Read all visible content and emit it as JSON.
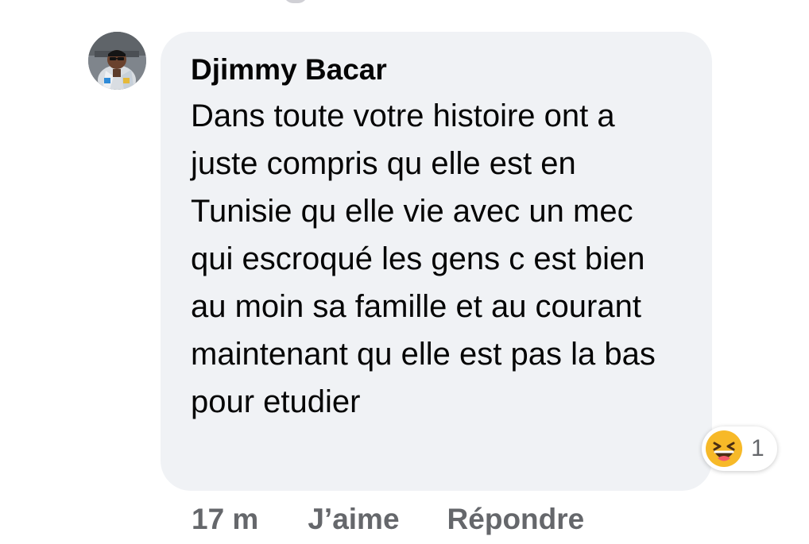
{
  "comment": {
    "author": "Djimmy Bacar",
    "text": "Dans toute votre histoire ont a juste compris qu elle est en Tunisie qu elle vie avec un mec qui escroqué les gens c est bien au moin sa famille et au courant maintenant qu elle est pas la bas pour etudier",
    "avatar_icon": "user-avatar"
  },
  "reactions": {
    "icon": "laughing-emoji-icon",
    "count": "1"
  },
  "actions": {
    "timestamp": "17 m",
    "like_label": "J’aime",
    "reply_label": "Répondre"
  },
  "colors": {
    "bubble": "#f0f2f5",
    "text": "#050505",
    "secondary": "#65676b",
    "emoji_yellow": "#f7b928"
  }
}
